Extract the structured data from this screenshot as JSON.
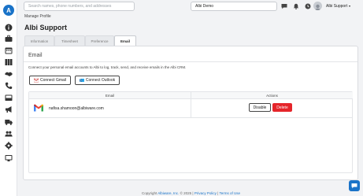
{
  "sidebar": {
    "logo_letter": "A",
    "items": [
      {
        "name": "info-icon"
      },
      {
        "name": "briefcase-icon"
      },
      {
        "name": "calendar-icon"
      },
      {
        "name": "grid-icon"
      },
      {
        "name": "handshake-icon"
      },
      {
        "name": "phone-icon"
      },
      {
        "name": "inbox-icon"
      },
      {
        "name": "megaphone-icon"
      },
      {
        "name": "truck-icon"
      },
      {
        "name": "users-icon"
      },
      {
        "name": "gear-icon"
      },
      {
        "name": "monitor-icon"
      }
    ]
  },
  "header": {
    "search_placeholder": "Search names, phone numbers, and addresses",
    "company": "Albi Demo",
    "user_name": "Albi Support",
    "user_caret": "▾"
  },
  "breadcrumb": "Manage Profile",
  "page_title": "Albi Support",
  "tabs": [
    {
      "label": "Information",
      "active": false
    },
    {
      "label": "Timesheet",
      "active": false
    },
    {
      "label": "Preference",
      "active": false
    },
    {
      "label": "Email",
      "active": true
    }
  ],
  "email_card": {
    "title": "Email",
    "description": "Connect your personal email accounts to Albi to log, track, send, and receive emails in the Albi CRM.",
    "connect_gmail_label": "Connect Gmail",
    "connect_outlook_label": "Connect Outlook",
    "table": {
      "headers": [
        "Email",
        "Actions"
      ],
      "rows": [
        {
          "email": "nafisa.shamoon@albiware.com",
          "disable_label": "Disable",
          "delete_label": "Delete"
        }
      ]
    }
  },
  "footer": {
    "copyright": "Copyright",
    "link_a": "Albiware, Inc.",
    "year": "© 2025",
    "sep": "|",
    "privacy": "Privacy Policy",
    "terms": "Terms of Use"
  },
  "colors": {
    "accent": "#1a73c8",
    "delete": "#e5252a",
    "background": "#f2f3f5"
  }
}
